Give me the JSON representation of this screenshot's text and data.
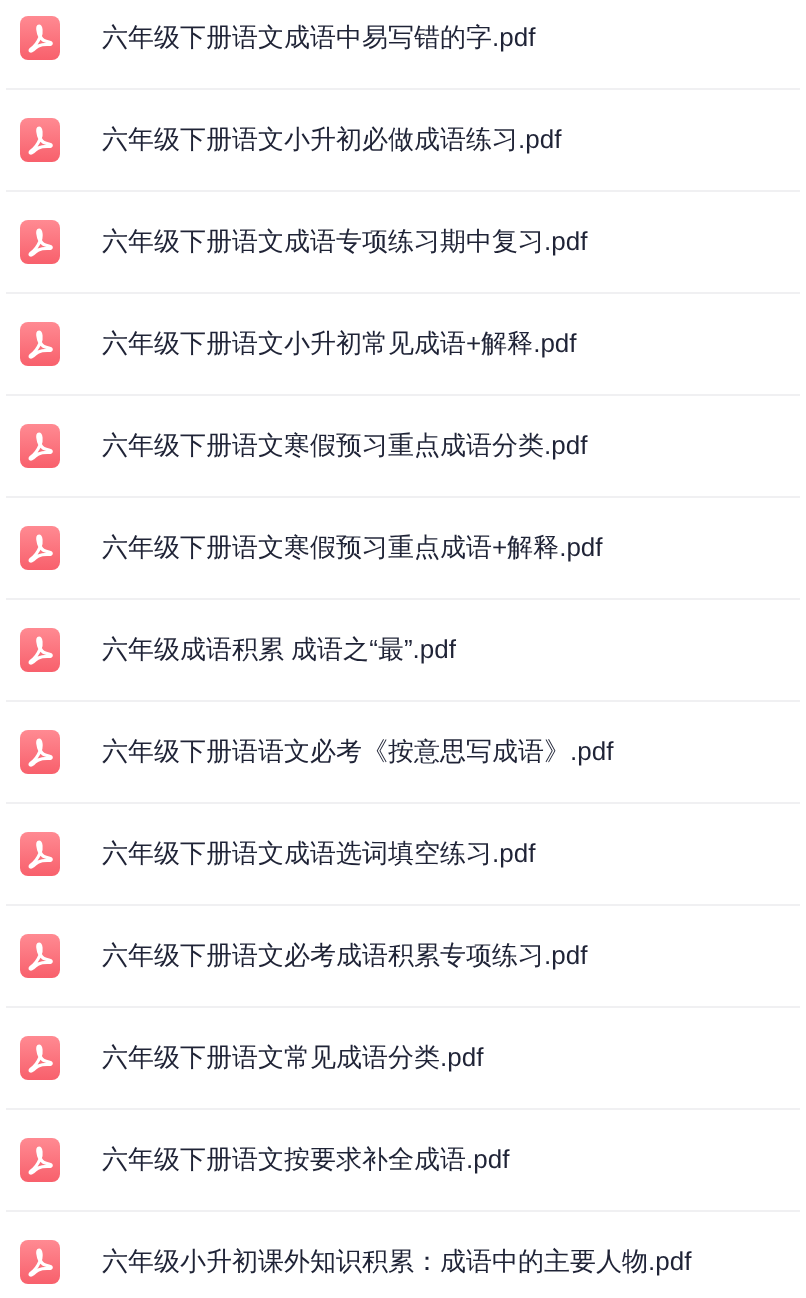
{
  "files": [
    {
      "name": "六年级下册语文成语中易写错的字.pdf"
    },
    {
      "name": "六年级下册语文小升初必做成语练习.pdf"
    },
    {
      "name": "六年级下册语文成语专项练习期中复习.pdf"
    },
    {
      "name": "六年级下册语文小升初常见成语+解释.pdf"
    },
    {
      "name": "六年级下册语文寒假预习重点成语分类.pdf"
    },
    {
      "name": "六年级下册语文寒假预习重点成语+解释.pdf"
    },
    {
      "name": "六年级成语积累 成语之“最”.pdf"
    },
    {
      "name": "六年级下册语语文必考《按意思写成语》.pdf"
    },
    {
      "name": "六年级下册语文成语选词填空练习.pdf"
    },
    {
      "name": "六年级下册语文必考成语积累专项练习.pdf"
    },
    {
      "name": "六年级下册语文常见成语分类.pdf"
    },
    {
      "name": "六年级下册语文按要求补全成语.pdf"
    },
    {
      "name": "六年级小升初课外知识积累：成语中的主要人物.pdf"
    }
  ]
}
